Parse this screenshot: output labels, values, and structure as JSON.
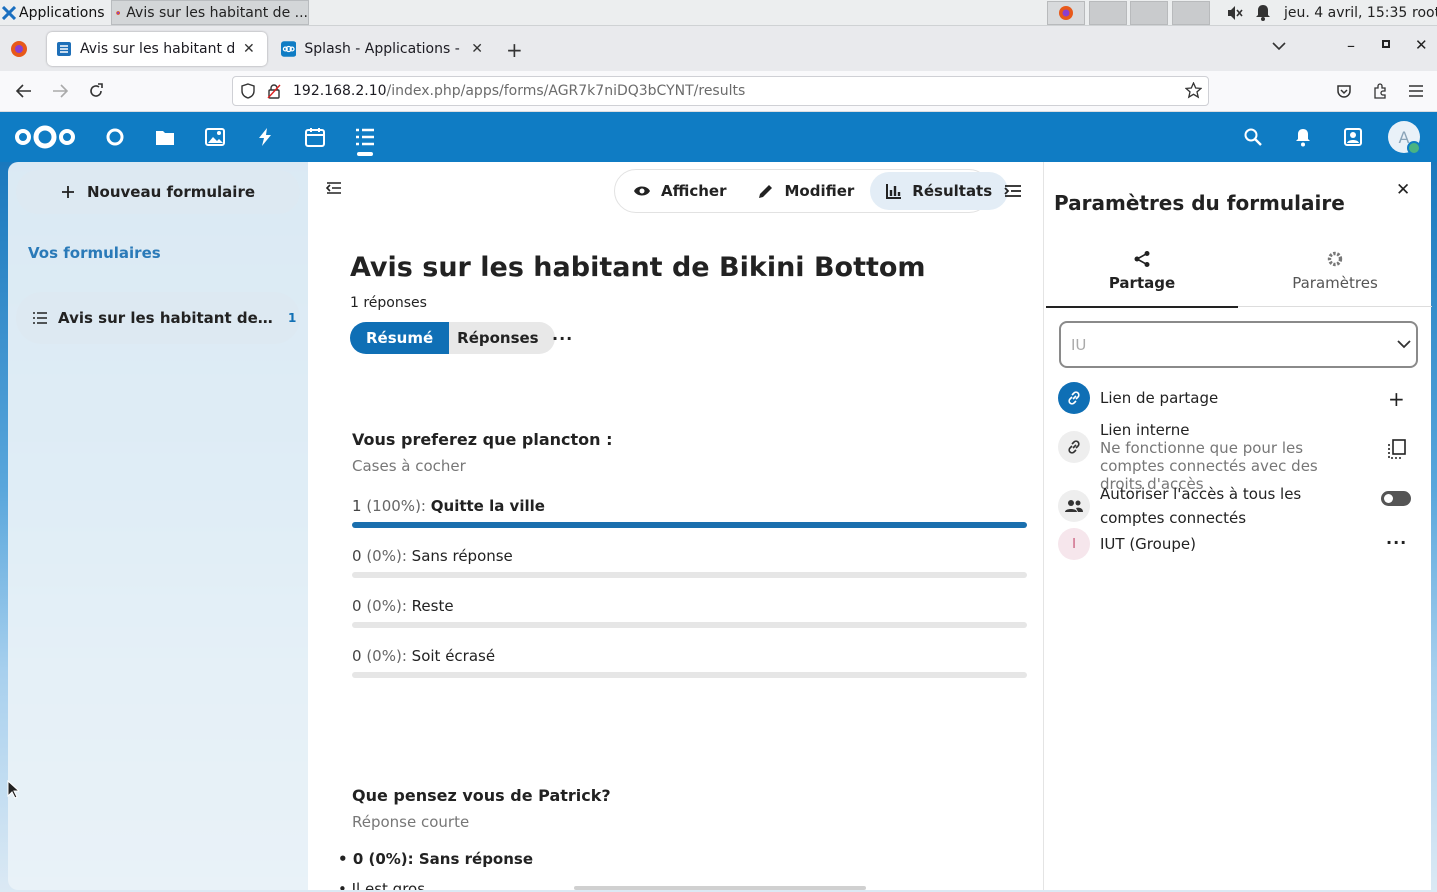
{
  "os": {
    "apps_label": "Applications",
    "task_title": "Avis sur les habitant de ...",
    "clock": "jeu. 4 avril, 15:35",
    "user": "root"
  },
  "browser": {
    "tabs": [
      {
        "title": "Avis sur les habitant de B",
        "active": true
      },
      {
        "title": "Splash - Applications - Ap",
        "active": false
      }
    ],
    "url_host": "192.168.2.10",
    "url_path": "/index.php/apps/forms/AGR7k7niDQ3bCYNT/results"
  },
  "header": {
    "avatar_letter": "A"
  },
  "sidebar": {
    "new_form": "Nouveau formulaire",
    "section": "Vos formulaires",
    "forms": [
      {
        "name": "Avis sur les habitant de Bikini Bottom",
        "count": "1"
      }
    ]
  },
  "toolbar": {
    "view": "Afficher",
    "edit": "Modifier",
    "results": "Résultats"
  },
  "form": {
    "title": "Avis sur les habitant de Bikini Bottom",
    "responses": "1 réponses",
    "summary_tab": "Résumé",
    "responses_tab": "Réponses"
  },
  "questions": [
    {
      "title": "Vous preferez que plancton :",
      "type": "Cases à cocher",
      "options": [
        {
          "count": "1",
          "pct": "(100%):",
          "label": "Quitte la ville",
          "fraction": 1.0
        },
        {
          "count": "0",
          "pct": "(0%):",
          "label": "Sans réponse",
          "fraction": 0
        },
        {
          "count": "0",
          "pct": "(0%):",
          "label": "Reste",
          "fraction": 0
        },
        {
          "count": "0",
          "pct": "(0%):",
          "label": "Soit écrasé",
          "fraction": 0
        }
      ]
    },
    {
      "title": "Que pensez vous de Patrick?",
      "type": "Réponse courte",
      "answers": [
        "0 (0%): Sans réponse",
        "Il est gros"
      ]
    }
  ],
  "settings": {
    "title": "Paramètres du formulaire",
    "tab_share": "Partage",
    "tab_settings": "Paramètres",
    "search_value": "IU",
    "share_link": "Lien de partage",
    "internal_link": "Lien interne",
    "internal_desc": "Ne fonctionne que pour les comptes connectés avec des droits d'accès",
    "allow_all": "Autoriser l'accès à tous les comptes connectés",
    "group_initial": "I",
    "group": "IUT (Groupe)"
  },
  "colors": {
    "brand": "#0f7cc4",
    "primary": "#0f6fb5"
  }
}
